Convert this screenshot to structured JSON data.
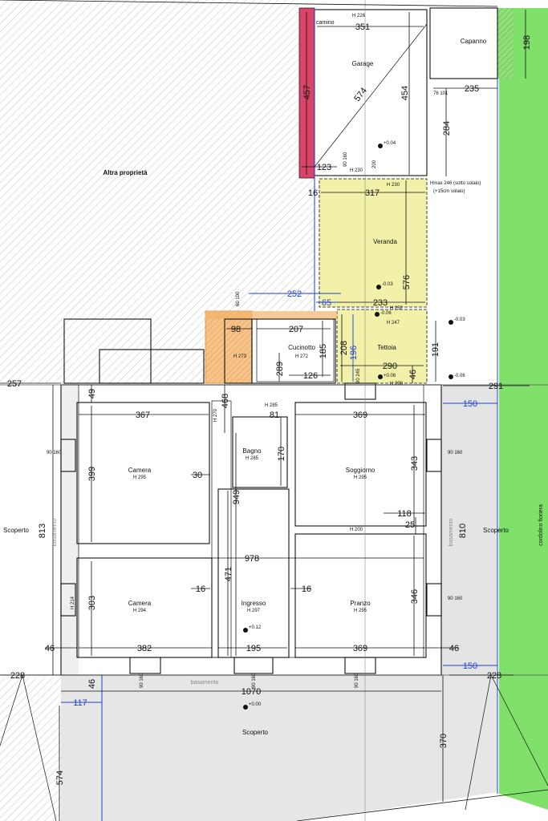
{
  "areas": {
    "altra_proprieta": "Altra proprietà",
    "scoperto_left": "Scoperto",
    "scoperto_right": "Scoperto",
    "scoperto_bottom": "Scoperto",
    "basamento_left": "basamento",
    "basamento_right": "basamento",
    "basamento_bottom": "basamento",
    "cordolino": "cordolino fioriera",
    "camino": "camino"
  },
  "rooms": {
    "garage": {
      "name": "Garage",
      "h": "H 226"
    },
    "capanno": {
      "name": "Capanno"
    },
    "veranda": {
      "name": "Veranda"
    },
    "tettoia": {
      "name": "Tettoia"
    },
    "cucinotto": {
      "name": "Cucinotto",
      "h": "H 272"
    },
    "bagno": {
      "name": "Bagno",
      "h": "H 285"
    },
    "camera1": {
      "name": "Camera",
      "h": "H 295"
    },
    "soggiorno": {
      "name": "Soggiorno",
      "h": "H 295"
    },
    "camera2": {
      "name": "Camera",
      "h": "H 294"
    },
    "ingresso": {
      "name": "Ingresso",
      "h": "H 297"
    },
    "pranzo": {
      "name": "Pranzo",
      "h": "H 295"
    },
    "ripostiglio": {
      "h": "H 273"
    }
  },
  "heights": {
    "h230a": "H 230",
    "h230b": "H 230",
    "h252": "H 252",
    "h247": "H 247",
    "h290": "H 290",
    "h285b": "H 285",
    "h200": "H 200",
    "h270": "H 270",
    "h214": "H 214",
    "hmax": "Hmax 246 (sotto solaio)",
    "hmax2": "(+15cm solaio)"
  },
  "levels": [
    "+0.04",
    "-0.03",
    "-0.03",
    "-0.06",
    "+0.06",
    "-0.06",
    "+0.12",
    "+0.00"
  ],
  "windows": {
    "w1": "90\n160",
    "w2": "90\n160",
    "w3": "90\n160",
    "w4": "90\n160",
    "w5": "90\n160",
    "w6": "90\n160",
    "w7": "90\n160",
    "w8": "76\n101",
    "w9": "60\n100",
    "w10": "90\n245"
  },
  "dims": {
    "d351": "351",
    "d457": "457",
    "d574a": "574",
    "d454": "454",
    "d198": "198",
    "d235": "235",
    "d284": "284",
    "d123": "123",
    "d200": "200",
    "d16a": "16",
    "d317": "317",
    "d576": "576",
    "d252": "252",
    "d65": "65",
    "d233": "233",
    "d98": "98",
    "d207": "207",
    "d185": "185",
    "d208": "208",
    "d196": "196",
    "d191": "191",
    "d290": "290",
    "d289": "289",
    "d126": "126",
    "d46a": "46",
    "d257": "257",
    "d291": "291",
    "d49": "49",
    "d468": "468",
    "d367": "367",
    "d81": "81",
    "d369a": "369",
    "d150a": "150",
    "d399": "399",
    "d30": "30",
    "d949": "949",
    "d170": "170",
    "d343": "343",
    "d118": "118",
    "d25": "25",
    "d813": "813",
    "d810": "810",
    "d978": "978",
    "d303": "303",
    "d471": "471",
    "d16b": "16",
    "d16c": "16",
    "d346": "346",
    "d46b": "46",
    "d382": "382",
    "d195": "195",
    "d369b": "369",
    "d46c": "46",
    "d150b": "150",
    "d228a": "228",
    "d228b": "228",
    "d46d": "46",
    "d1070": "1070",
    "d117": "117",
    "d370": "370",
    "d574b": "574"
  },
  "colors": {
    "red": "#d9456a",
    "yellow": "#f1f1a9",
    "orange": "#f4b46a",
    "green": "#7fe06a",
    "grey": "#e6e6e6",
    "blue": "#1f3fd8"
  }
}
